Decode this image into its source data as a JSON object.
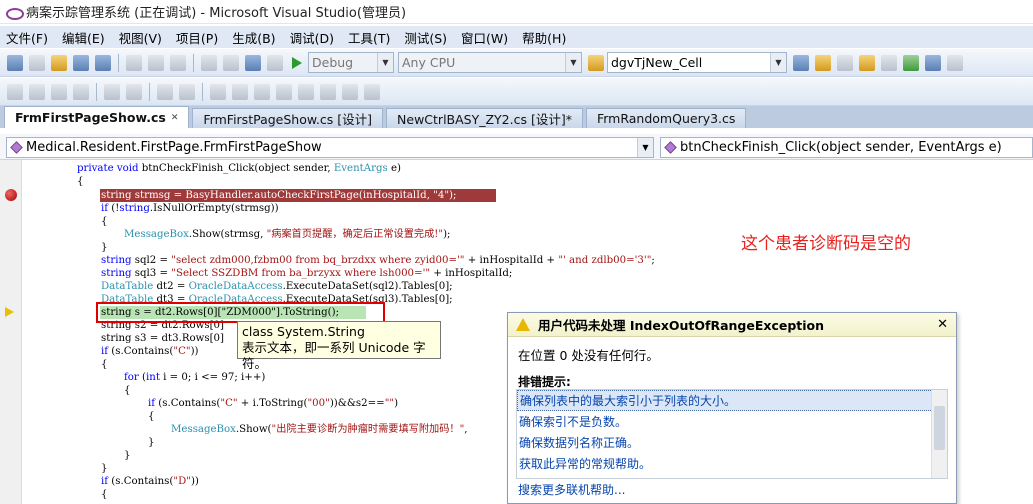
{
  "window": {
    "title": "病案示踪管理系统 (正在调试) - Microsoft Visual Studio(管理员)"
  },
  "menu": [
    "文件(F)",
    "编辑(E)",
    "视图(V)",
    "项目(P)",
    "生成(B)",
    "调试(D)",
    "工具(T)",
    "测试(S)",
    "窗口(W)",
    "帮助(H)"
  ],
  "toolbar": {
    "config": "Debug",
    "platform": "Any CPU",
    "find": "dgvTjNew_Cell"
  },
  "tabs": [
    {
      "label": "FrmFirstPageShow.cs",
      "active": true
    },
    {
      "label": "FrmFirstPageShow.cs [设计]",
      "active": false
    },
    {
      "label": "NewCtrlBASY_ZY2.cs [设计]*",
      "active": false
    },
    {
      "label": "FrmRandomQuery3.cs",
      "active": false
    }
  ],
  "nav": {
    "type": "Medical.Resident.FirstPage.FrmFirstPageShow",
    "member": "btnCheckFinish_Click(object sender, EventArgs e)"
  },
  "code": {
    "l0a": "private void ",
    "l0b": "btnCheckFinish_Click(object sender, ",
    "l0c": "EventArgs",
    " l0d": " e)",
    "l1": "{",
    "l2": "string strmsg = BasyHandler.autoCheckFirstPage(inHospitalId, \"4\");",
    "l3a": "if (!",
    "l3b": "string",
    ".l3c": ".IsNullOrEmpty(strmsg))",
    "l4": "{",
    "l5a": "MessageBox",
    ".l5b": ".Show(strmsg, ",
    "l5c": "\"病案首页提醒，确定后正常设置完成!\"",
    "l5d": ");",
    "l6": "}",
    "l7a": "string",
    " l7b": " sql2 = ",
    "l7c": "\"select zdm000,fzbm00 from bq_brzdxx where zyid00='\"",
    "l7d": " + inHospitalId + ",
    "l7e": "\"' and zdlb00='3'\"",
    "l7f": ";",
    "l8a": "string",
    "l8b": " sql3 = ",
    "l8c": "\"Select SSZDBM from ba_brzyxx where lsh000='\"",
    "l8d": " + inHospitalId;",
    "l9a": "DataTable",
    " l9b": " dt2 = ",
    "l9c": "OracleDataAccess",
    ".l9d": ".ExecuteDataSet(sql2).Tables[0];",
    "l10a": "DataTable",
    "l10b": " dt3 = ",
    "l10c": "OracleDataAccess",
    "l10d": ".ExecuteDataSet(sql3).Tables[0];",
    "l11": "string s = dt2.Rows[0][\"ZDM000\"].ToString();",
    "l12": "string s2 = dt2.Rows[0]",
    "l13": "string s3 = dt3.Rows[0]",
    "l14a": "if (s.Contains(",
    "l14b": "\"C\"",
    "l14c": "))",
    "l15": "{",
    "l16a": "for",
    " l16b": " (",
    "l16c": "int",
    " l16d": " i = 0; i <= 97; i++)",
    "l17": "{",
    "l18a": "if",
    " l18b": " (s.Contains(",
    "l18c": "\"C\"",
    "l18d": " + i.ToString(",
    "l18e": "\"00\"",
    "l18f": "))&&s2==",
    "l18g": "\"\"",
    ")": ")",
    "l19a": "{",
    "l20a": "MessageBox",
    "l20b": ".Show(",
    "l20c": "\"出院主要诊断为肿瘤时需要填写附加码！\"",
    "l20d": ",",
    "l21": "}",
    "l22": "}",
    "l23": "}",
    "l24a": "if (s.Contains(",
    "l24b": "\"D\"",
    "l24c": "))",
    "l25": "{"
  },
  "annotation": "这个患者诊断码是空的",
  "tooltip": {
    "line1": "class System.String",
    "line2": "表示文本，即一系列 Unicode 字符。"
  },
  "exception": {
    "title": "用户代码未处理 IndexOutOfRangeException",
    "close": "✕",
    "message": "在位置 0 处没有任何行。",
    "tips_label": "排错提示:",
    "tips": [
      "确保列表中的最大索引小于列表的大小。",
      "确保索引不是负数。",
      "确保数据列名称正确。",
      "获取此异常的常规帮助。"
    ],
    "more": "搜索更多联机帮助..."
  }
}
